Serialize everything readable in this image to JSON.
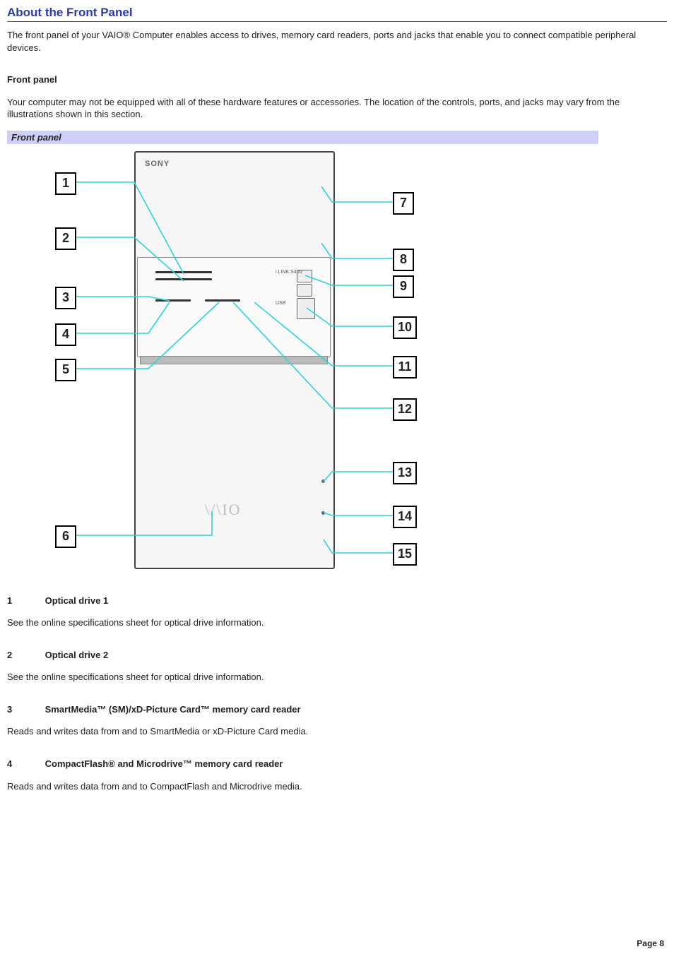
{
  "title": "About the Front Panel",
  "intro": "The front panel of your VAIO® Computer enables access to drives, memory card readers, ports and jacks that enable you to connect compatible peripheral devices.",
  "sub1": "Front panel",
  "sub1_para": "Your computer may not be equipped with all of these hardware features or accessories. The location of the controls, ports, and jacks may vary from the illustrations shown in this section.",
  "fig_caption": "Front panel",
  "brand_text": "SONY",
  "vaio_logo_text": "\\/\\IO",
  "tiny_label_ilink": "i.LINK S400",
  "tiny_label_usb": "USB",
  "callouts": {
    "n1": "1",
    "n2": "2",
    "n3": "3",
    "n4": "4",
    "n5": "5",
    "n6": "6",
    "n7": "7",
    "n8": "8",
    "n9": "9",
    "n10": "10",
    "n11": "11",
    "n12": "12",
    "n13": "13",
    "n14": "14",
    "n15": "15"
  },
  "items": [
    {
      "num": "1",
      "head": "Optical drive 1",
      "desc": "See the online specifications sheet for optical drive information."
    },
    {
      "num": "2",
      "head": "Optical drive 2",
      "desc": "See the online specifications sheet for optical drive information."
    },
    {
      "num": "3",
      "head": "SmartMedia™ (SM)/xD-Picture Card™ memory card reader",
      "desc": "Reads and writes data from and to SmartMedia or xD-Picture Card media."
    },
    {
      "num": "4",
      "head": "CompactFlash® and Microdrive™ memory card reader",
      "desc": "Reads and writes data from and to CompactFlash and Microdrive media."
    }
  ],
  "page_label": "Page 8"
}
